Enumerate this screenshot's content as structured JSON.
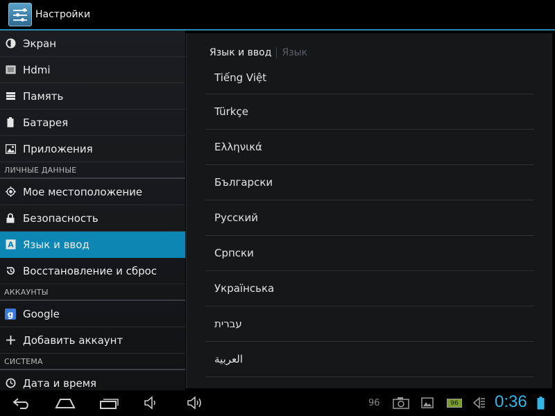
{
  "actionbar": {
    "title": "Настройки"
  },
  "sidebar": {
    "device_items": [
      {
        "label": "Экран",
        "icon": "brightness-icon"
      },
      {
        "label": "Hdmi",
        "icon": "hdmi-icon"
      },
      {
        "label": "Память",
        "icon": "storage-icon"
      },
      {
        "label": "Батарея",
        "icon": "battery-icon"
      },
      {
        "label": "Приложения",
        "icon": "apps-icon"
      }
    ],
    "personal_header": "ЛИЧНЫЕ ДАННЫЕ",
    "personal_items": [
      {
        "label": "Мое местоположение",
        "icon": "location-icon"
      },
      {
        "label": "Безопасность",
        "icon": "lock-icon"
      },
      {
        "label": "Язык и ввод",
        "icon": "language-icon",
        "active": true
      },
      {
        "label": "Восстановление и сброс",
        "icon": "restore-icon"
      }
    ],
    "accounts_header": "АККАУНТЫ",
    "account_items": [
      {
        "label": "Google",
        "icon": "google-icon"
      },
      {
        "label": "Добавить аккаунт",
        "icon": "plus-icon"
      }
    ],
    "system_header": "СИСТЕМА",
    "system_items": [
      {
        "label": "Дата и время",
        "icon": "clock-icon"
      }
    ]
  },
  "content": {
    "breadcrumb_main": "Язык и ввод",
    "breadcrumb_sub": "Язык",
    "languages": [
      "Tiếng Việt",
      "Türkçe",
      "Ελληνικά",
      "Български",
      "Русский",
      "Српски",
      "Українська",
      "עברית",
      "العربية"
    ]
  },
  "statusbar": {
    "notification_count": "96",
    "battery_level": "96",
    "time": "0:36"
  },
  "colors": {
    "accent": "#33b5e5",
    "active_row": "#0e86b4",
    "divider_blue": "#2a8fb6"
  }
}
